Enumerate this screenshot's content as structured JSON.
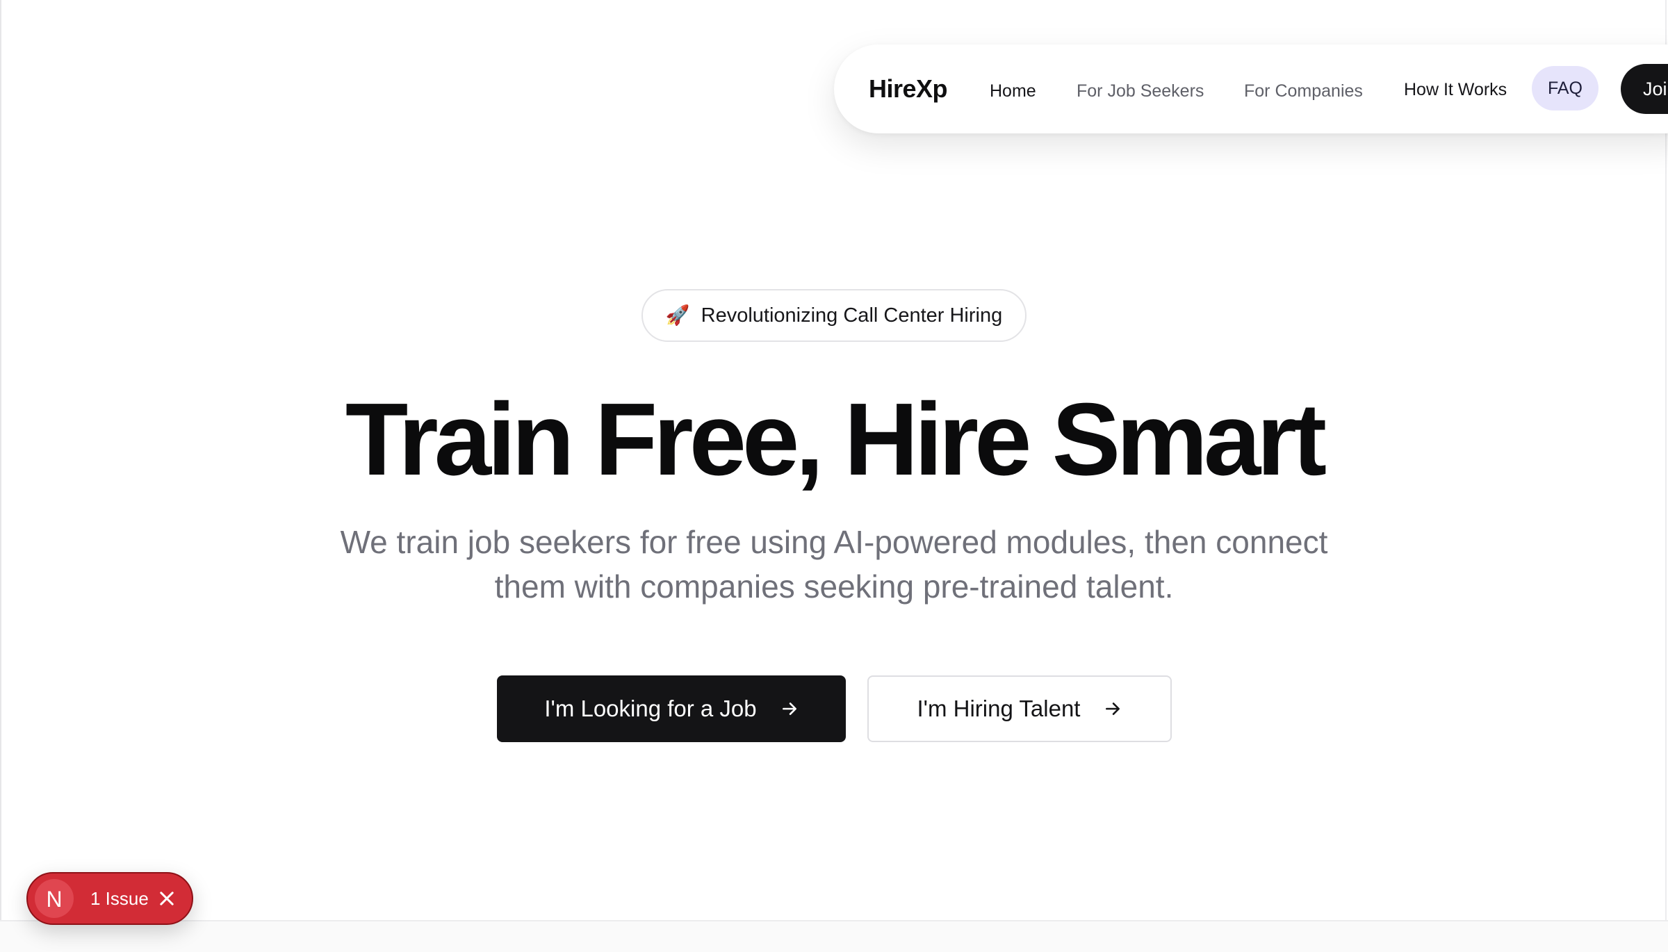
{
  "nav": {
    "brand": "HireXp",
    "links": [
      "Home",
      "For Job Seekers",
      "For Companies",
      "How It Works"
    ],
    "faq": "FAQ",
    "join": "Join"
  },
  "hero": {
    "badge_icon": "rocket-icon",
    "badge_emoji": "🚀",
    "badge_text": "Revolutionizing Call Center Hiring",
    "title": "Train Free, Hire Smart",
    "subtitle_line1": "We train job seekers for free using AI-powered modules, then connect",
    "subtitle_line2": "them with companies seeking pre-trained talent.",
    "primary_cta": "I'm Looking for a Job",
    "secondary_cta": "I'm Hiring Talent"
  },
  "issue_toast": {
    "logo": "N",
    "label": "1 Issue"
  },
  "colors": {
    "primary": "#141416",
    "faq_bg": "#e6e4fb",
    "issue_red": "#d22c36"
  }
}
